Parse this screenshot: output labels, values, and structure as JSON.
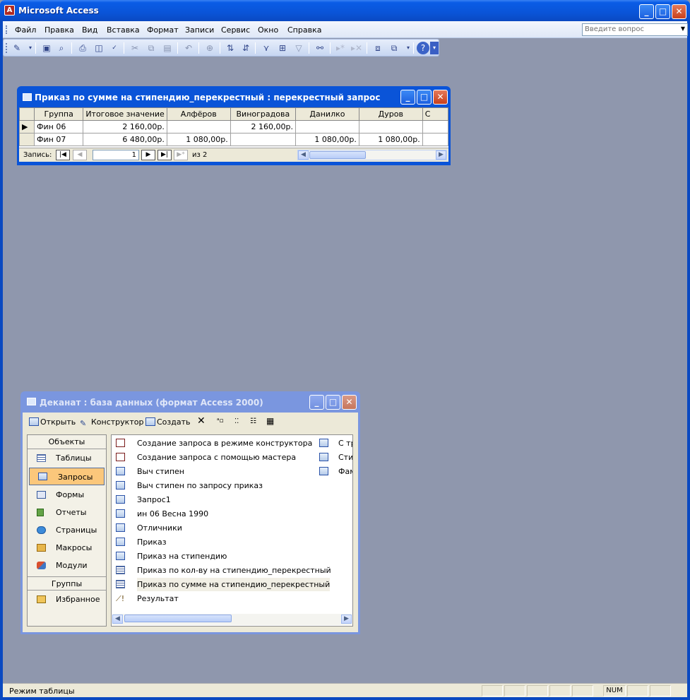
{
  "app": {
    "title": "Microsoft Access",
    "icon": "A"
  },
  "menu": {
    "items": [
      "Файл",
      "Правка",
      "Вид",
      "Вставка",
      "Формат",
      "Записи",
      "Сервис",
      "Окно",
      "Справка"
    ],
    "help_placeholder": "Введите вопрос"
  },
  "query_window": {
    "title": "Приказ по сумме на стипендию_перекрестный : перекрестный запрос",
    "columns": [
      "Группа",
      "Итоговое значение",
      "Алфёров",
      "Виноградова",
      "Данилко",
      "Дуров",
      "С"
    ],
    "rows": [
      [
        "Фин 06",
        "2 160,00р.",
        "",
        "2 160,00р.",
        "",
        "",
        ""
      ],
      [
        "Фин 07",
        "6 480,00р.",
        "1 080,00р.",
        "",
        "1 080,00р.",
        "1 080,00р.",
        ""
      ]
    ],
    "nav": {
      "label": "Запись:",
      "current": "1",
      "of_text": "из  2"
    }
  },
  "db_window": {
    "title": "Деканат : база данных (формат Access 2000)",
    "toolbar": {
      "open": "Открыть",
      "design": "Конструктор",
      "create": "Создать"
    },
    "objects_header": "Объекты",
    "objects": [
      "Таблицы",
      "Запросы",
      "Формы",
      "Отчеты",
      "Страницы",
      "Макросы",
      "Модули"
    ],
    "groups_header": "Группы",
    "groups": [
      "Избранное"
    ],
    "list_col1": [
      "Создание запроса в режиме конструктора",
      "Создание запроса с помощью мастера",
      "Выч стипен",
      "Выч стипен по запросу приказ",
      "Запрос1",
      "ин 06 Весна 1990",
      "Отличники",
      "Приказ",
      "Приказ на стипендию",
      "Приказ по кол-ву на стипендию_перекрестный",
      "Приказ по сумме на стипендию_перекрестный",
      "Результат"
    ],
    "list_col2": [
      "С тр",
      "Сти",
      "Фам"
    ]
  },
  "status": {
    "text": "Режим таблицы",
    "num": "NUM"
  }
}
